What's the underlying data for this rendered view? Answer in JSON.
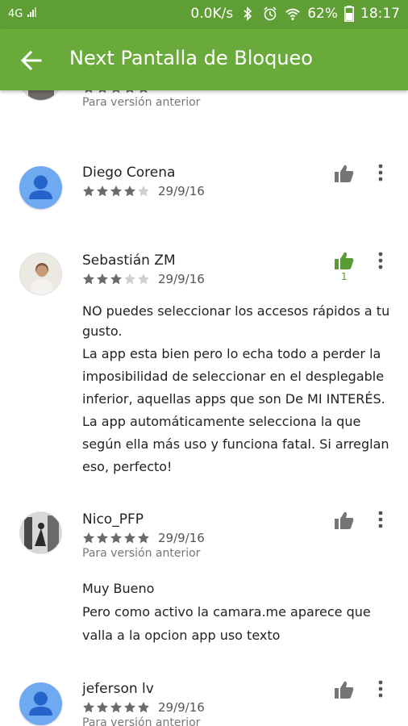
{
  "status_bar": {
    "network": "4G",
    "speed": "0.0K/s",
    "battery": "62%",
    "time": "18:17"
  },
  "app_bar": {
    "title": "Next Pantalla de Bloqueo",
    "back_icon": "arrow-back-icon"
  },
  "reviews": [
    {
      "name": "",
      "stars": 5,
      "date": "",
      "version_note": "Para versión anterior",
      "avatar": "photo"
    },
    {
      "name": "Diego Corena",
      "stars": 4,
      "date": "29/9/16",
      "avatar": "generic",
      "helpful": false
    },
    {
      "name": "Sebastián ZM",
      "stars": 3,
      "date": "29/9/16",
      "avatar": "photo",
      "helpful": true,
      "helpful_count": "1",
      "title": "NO puedes seleccionar los accesos rápidos a tu gusto.",
      "body": "La app esta bien pero lo echa todo a perder la imposibilidad de seleccionar en el desplegable inferior, aquellas apps que son De MI INTERÉS. La app automáticamente selecciona la que según ella más uso y funciona fatal. Si arreglan eso, perfecto!"
    },
    {
      "name": "Nico_PFP",
      "stars": 5,
      "date": "29/9/16",
      "version_note": "Para versión anterior",
      "avatar": "photo",
      "title": "Muy Bueno",
      "body": "Pero como activo la camara.me aparece que valla a la opcion app uso texto"
    },
    {
      "name": "jeferson lv",
      "stars": 5,
      "date": "29/9/16",
      "version_note": "Para versión anterior",
      "avatar": "generic"
    }
  ],
  "colors": {
    "status_bar": "#5f9e34",
    "app_bar": "#6aaa3a",
    "star_filled": "#6b6b6b",
    "star_empty": "#cfcfcf",
    "thumb_default": "#757575",
    "thumb_active": "#5a9c34",
    "avatar_generic": "#6fa9f1"
  }
}
